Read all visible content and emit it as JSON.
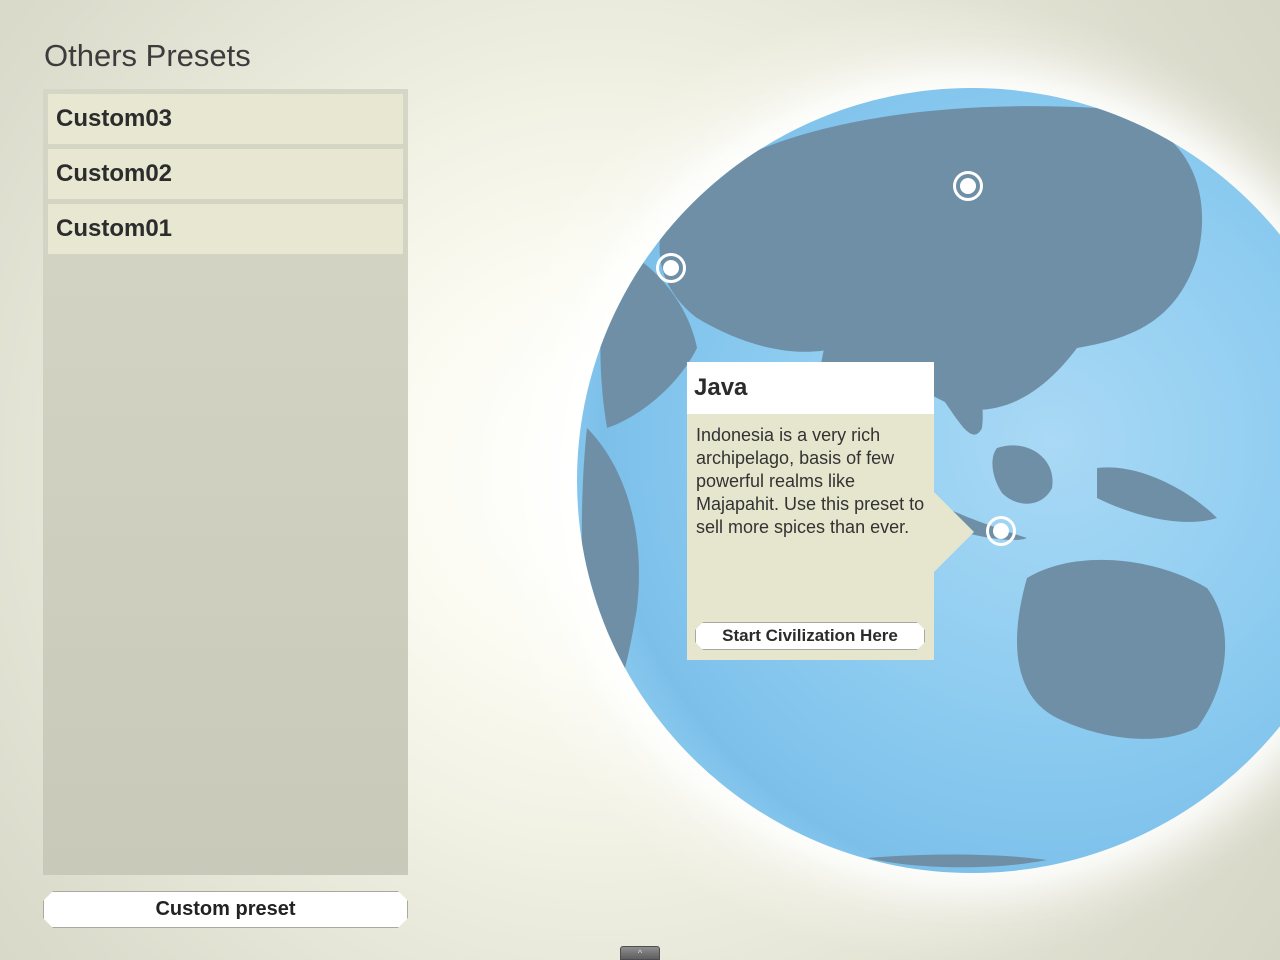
{
  "panel": {
    "title": "Others Presets",
    "presets": [
      {
        "label": "Custom03"
      },
      {
        "label": "Custom02"
      },
      {
        "label": "Custom01"
      }
    ],
    "custom_preset_label": "Custom preset"
  },
  "tooltip": {
    "title": "Java",
    "description": "Indonesia is a very rich archipelago, basis of few powerful realms like Majapahit. Use this preset to sell more spices than ever.",
    "start_label": "Start Civilization Here"
  },
  "bottom_tab": {
    "icon": "chevron-up-icon",
    "glyph": "^"
  },
  "colors": {
    "globe_ocean": "#8ccbf0",
    "land": "#6f8fa7",
    "panel_bg": "#d6d6c6",
    "item_bg": "#e7e7d2",
    "tooltip_bg": "#e6e5cd"
  }
}
